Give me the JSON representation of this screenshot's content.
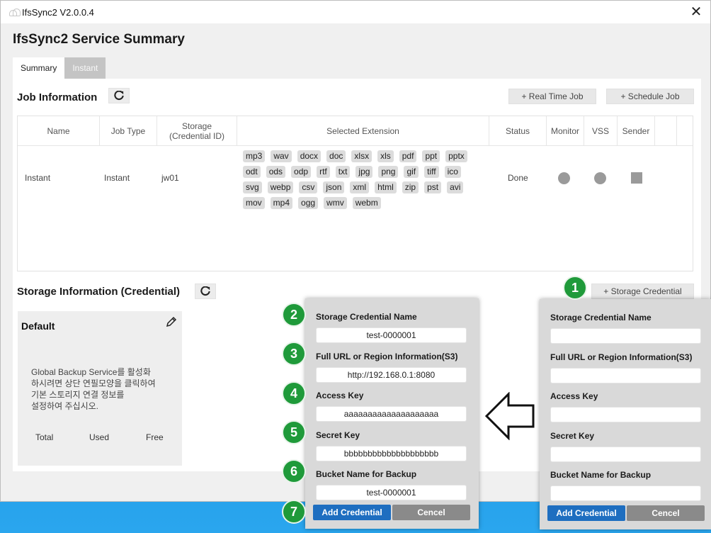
{
  "window": {
    "title": "IfsSync2 V2.0.0.4",
    "close_glyph": "✕"
  },
  "page": {
    "title": "IfsSync2 Service Summary"
  },
  "tabs": [
    {
      "label": "Summary"
    },
    {
      "label": "Instant"
    }
  ],
  "job_section": {
    "title": "Job Information",
    "real_time_btn": "+ Real Time Job",
    "schedule_btn": "+ Schedule Job",
    "columns": [
      "Name",
      "Job Type",
      "Storage\n(Credential ID)",
      "Selected Extension",
      "Status",
      "Monitor",
      "VSS",
      "Sender"
    ],
    "row": {
      "name": "Instant",
      "job_type": "Instant",
      "storage": "jw01",
      "extensions": [
        "mp3",
        "wav",
        "docx",
        "doc",
        "xlsx",
        "xls",
        "pdf",
        "ppt",
        "pptx",
        "odt",
        "ods",
        "odp",
        "rtf",
        "txt",
        "jpg",
        "png",
        "gif",
        "tiff",
        "ico",
        "svg",
        "webp",
        "csv",
        "json",
        "xml",
        "html",
        "zip",
        "pst",
        "avi",
        "mov",
        "mp4",
        "ogg",
        "wmv",
        "webm"
      ],
      "status": "Done"
    }
  },
  "storage_section": {
    "title": "Storage Information (Credential)",
    "add_btn": "+ Storage Credential",
    "card": {
      "title": "Default",
      "description": "Global Backup Service를 활성화\n하시려면 상단 연필모양을 클릭하여\n기본 스토리지 연결 정보를\n설정하여 주십시오.",
      "total": "Total",
      "used": "Used",
      "free": "Free"
    }
  },
  "form_filled": {
    "fields": [
      {
        "label": "Storage Credential Name",
        "value": "test-0000001"
      },
      {
        "label": "Full URL or Region Information(S3)",
        "value": "http://192.168.0.1:8080"
      },
      {
        "label": "Access Key",
        "value": "aaaaaaaaaaaaaaaaaaaa"
      },
      {
        "label": "Secret Key",
        "value": "bbbbbbbbbbbbbbbbbbbb"
      },
      {
        "label": "Bucket Name for Backup",
        "value": "test-0000001"
      }
    ],
    "add_btn": "Add Credential",
    "cancel_btn": "Cencel"
  },
  "form_empty": {
    "fields": [
      {
        "label": "Storage Credential Name",
        "value": ""
      },
      {
        "label": "Full URL or Region Information(S3)",
        "value": ""
      },
      {
        "label": "Access Key",
        "value": ""
      },
      {
        "label": "Secret Key",
        "value": ""
      },
      {
        "label": "Bucket Name for Backup",
        "value": ""
      }
    ],
    "add_btn": "Add Credential",
    "cancel_btn": "Cencel"
  },
  "badges": [
    "1",
    "2",
    "3",
    "4",
    "5",
    "6",
    "7"
  ],
  "colors": {
    "badge": "#1f9a3a",
    "primary_button": "#1e6ec0",
    "cancel_button": "#8a8a8a",
    "indicator": "#9a9a9a"
  }
}
